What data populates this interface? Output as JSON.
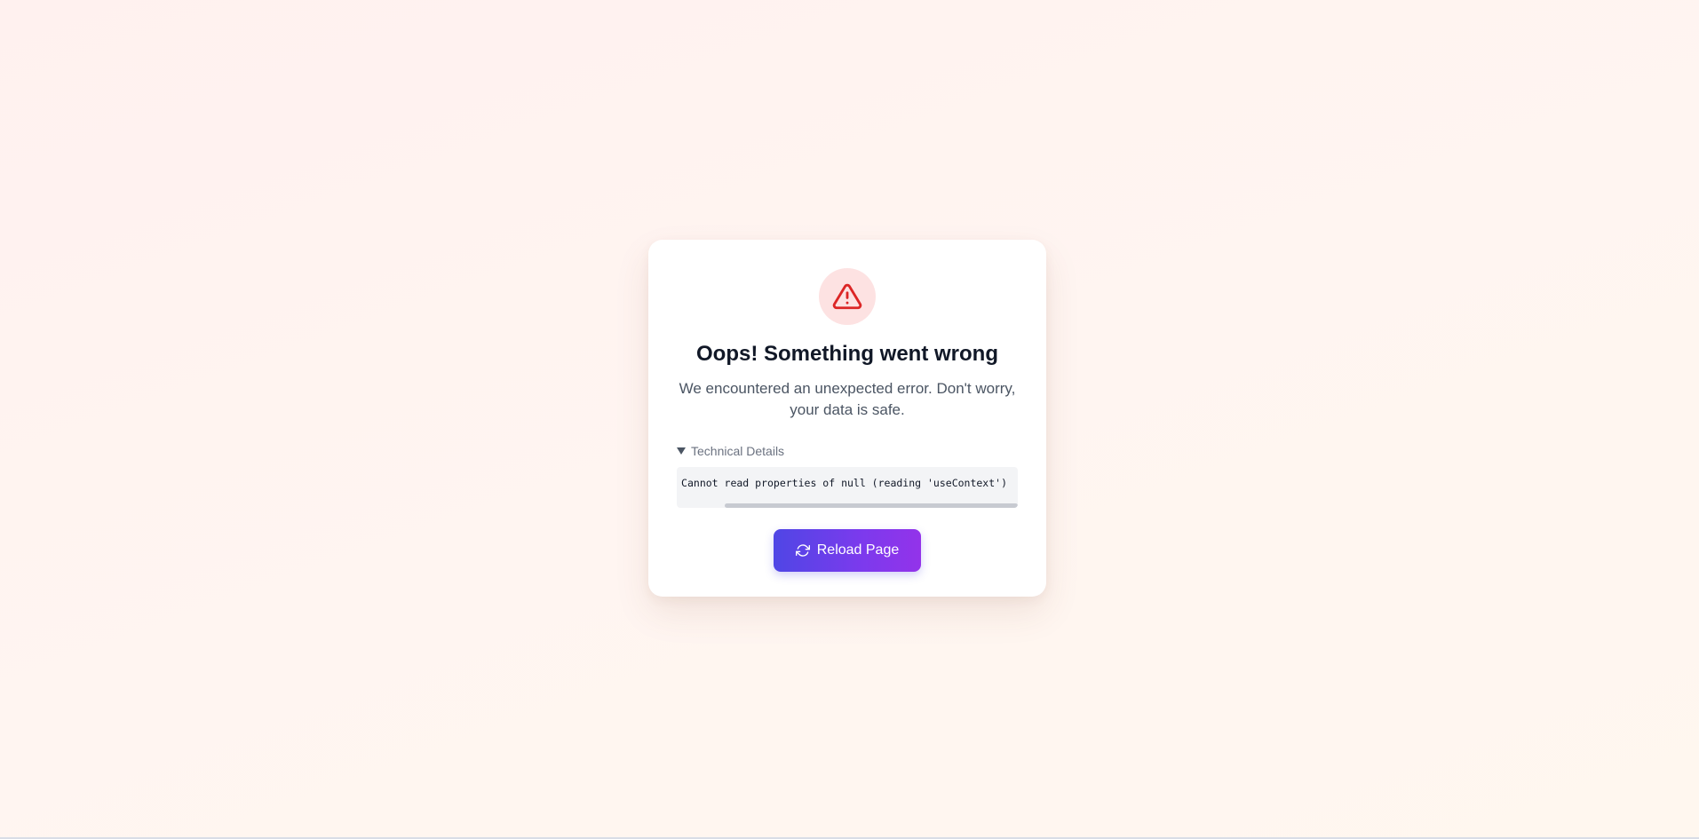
{
  "error": {
    "title": "Oops! Something went wrong",
    "message_line1": "We encountered an unexpected error. Don't worry,",
    "message_line2": "your data is safe.",
    "icon": "alert-triangle-icon",
    "details": {
      "summary_label": "Technical Details",
      "expanded": true,
      "code_text": "TypeError: Cannot read properties of null (reading 'useContext')"
    }
  },
  "actions": {
    "reload_label": "Reload Page",
    "reload_icon": "refresh-icon"
  },
  "colors": {
    "accent_start": "#4f46e5",
    "accent_end": "#9333ea",
    "error_red": "#dc2626",
    "error_bg": "#fde2e2"
  }
}
